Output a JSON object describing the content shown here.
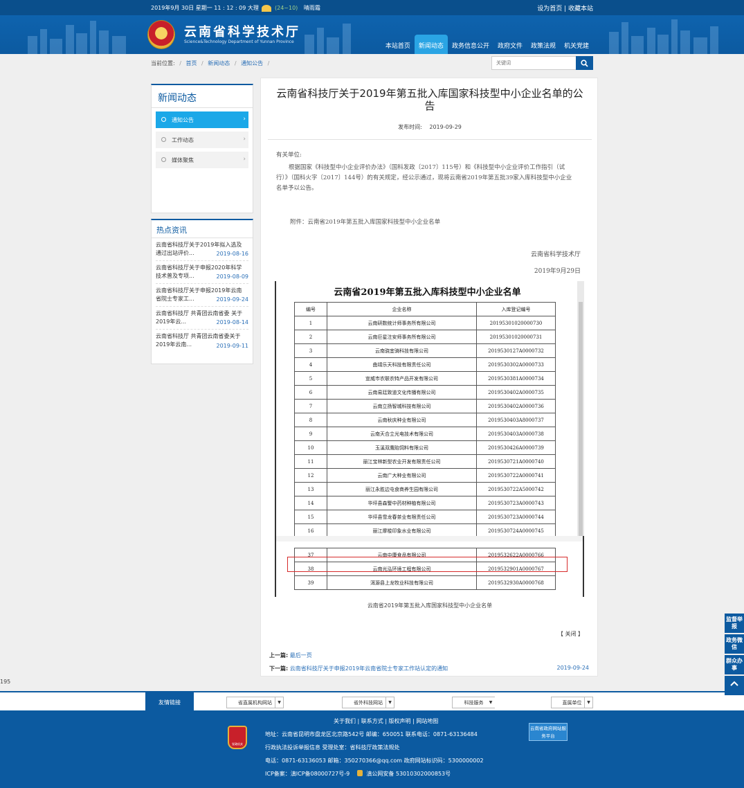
{
  "topbar": {
    "date": "2019年9月 30日 星期一 11 : 12 : 09",
    "weather_city": "大理",
    "weather_temp": "(24~10)",
    "weather_desc": "晴雨霜",
    "links": "设为首页 | 收藏本站"
  },
  "header": {
    "site_name": "云南省科学技术厅",
    "site_name_en": "Science&Technology Department of Yunnan Province",
    "nav": [
      "本站首页",
      "新闻动态",
      "政务信息公开",
      "政府文件",
      "政策法规",
      "机关党建"
    ],
    "active_nav": "新闻动态"
  },
  "breadcrumb": {
    "label": "当前位置:",
    "items": [
      "首页",
      "新闻动态",
      "通知公告"
    ]
  },
  "search": {
    "placeholder": "关键词"
  },
  "sidebar": {
    "title": "新闻动态",
    "items": [
      "通知公告",
      "工作动态",
      "媒体聚焦"
    ],
    "active": "通知公告"
  },
  "hot": {
    "title": "热点资讯",
    "items": [
      {
        "text": "云南省科技厅关于2019年拟入选及通过出站评价...",
        "date": "2019-08-16"
      },
      {
        "text": "云南省科技厅关于申报2020年科学技术普及专项...",
        "date": "2019-08-09"
      },
      {
        "text": "云南省科技厅关于申报2019年云南省院士专家工...",
        "date": "2019-09-24"
      },
      {
        "text": "云南省科技厅 共青团云南省委 关于2019年云...",
        "date": "2019-08-14"
      },
      {
        "text": "云南省科技厅 共青团云南省委关于2019年云南...",
        "date": "2019-09-11"
      }
    ]
  },
  "article": {
    "title": "云南省科技厅关于2019年第五批入库国家科技型中小企业名单的公告",
    "pub_label": "发布时间:",
    "pub_date": "2019-09-29",
    "greeting": "有关单位:",
    "paragraph": "根据国家《科技型中小企业评价办法》（国科发政〔2017〕115号）和《科技型中小企业评价工作指引（试行）》（国科火字〔2017〕144号）的有关规定，经公示通过，现将云南省2019年第五批39家入库科技型中小企业名单予以公告。",
    "attachment": "附件：云南省2019年第五批入库国家科技型中小企业名单",
    "signer": "云南省科学技术厅",
    "sign_date": "2019年9月29日",
    "caption": "云南省2019年第五批入库国家科技型中小企业名单",
    "close": "【 关闭 】",
    "prev_label": "上一篇:",
    "prev_title": "最后一页",
    "next_label": "下一篇:",
    "next_title": "云南省科技厅关于申报2019年云南省院士专家工作站认定的通知",
    "next_date": "2019-09-24"
  },
  "company_table": {
    "title": "云南省2019年第五批入库科技型中小企业名单",
    "headers": [
      "编号",
      "企业名称",
      "入库登记编号"
    ],
    "rows_top": [
      [
        "1",
        "云南研数统计师事务所有限公司",
        "20195301020000730"
      ],
      [
        "2",
        "云南巨星注安师事务所有限公司",
        "20195301020000731"
      ],
      [
        "3",
        "云南骁宜骑科技有限公司",
        "2019530127A0000732"
      ],
      [
        "4",
        "曲靖乐天科技有限责任公司",
        "2019530302A0000733"
      ],
      [
        "5",
        "宣威市农联农特产品开发有限公司",
        "2019530381A0000734"
      ],
      [
        "6",
        "云南易廷致道文化传播有限公司",
        "2019530402A0000735"
      ],
      [
        "7",
        "云南立扬智城科技有限公司",
        "2019530402A0000736"
      ],
      [
        "8",
        "云南秋庆种业有限公司",
        "2019530403A8000737"
      ],
      [
        "9",
        "云南天合立光电技术有限公司",
        "2019530403A0000738"
      ],
      [
        "10",
        "玉溪双鹰贻饲料有限公司",
        "2019530426A0000739"
      ],
      [
        "11",
        "丽江宝林新型农业开发有限责任公司",
        "2019530721A0000740"
      ],
      [
        "12",
        "云南广大种业有限公司",
        "2019530722A0000741"
      ],
      [
        "13",
        "丽江永胜边屯食商养生园有限公司",
        "2019530722A5000742"
      ],
      [
        "14",
        "华坪县森警中药材种植有限公司",
        "2019530723A0000743"
      ],
      [
        "15",
        "华坪县雪龙春茶业有限责任公司",
        "2019530723A0000744"
      ],
      [
        "16",
        "丽江摩梭印象水业有限公司",
        "2019530724A0000745"
      ]
    ],
    "rows_bottom": [
      [
        "37",
        "云南中康食品有限公司",
        "2019532622A0000766"
      ],
      [
        "38",
        "云南光泓环境工程有限公司",
        "2019532901A0000767"
      ],
      [
        "39",
        "洱源县上龙牧业科技有限公司",
        "2019532930A0000768"
      ]
    ],
    "highlighted_row": "38"
  },
  "page_counter": "195",
  "links_bar": {
    "label": "友情链接",
    "selects": [
      "省直属机构网站",
      "省外科技网站",
      "科技服务",
      "直属单位"
    ]
  },
  "footer": {
    "links": "关于我们 | 联系方式 | 版权声明 | 网站地图",
    "address": "地址：云南省昆明市盘龙区北京路542号    邮编：650051    联系电话：0871-63136484",
    "report": "行政执法投诉举报信息    受理处室：省科技厅政策法规处",
    "contact": "电话：0871-63136053    邮箱：350270366@qq.com    政府网站标识码：5300000002",
    "icp": "ICP备案：滇ICP备08000727号-9",
    "police": "滇公网安备 53010302000853号",
    "badge_text": "党政机关",
    "gov_badge": "云南省政府网站服务平台"
  },
  "float_buttons": [
    "监督举报",
    "政务微信",
    "群众办事"
  ]
}
